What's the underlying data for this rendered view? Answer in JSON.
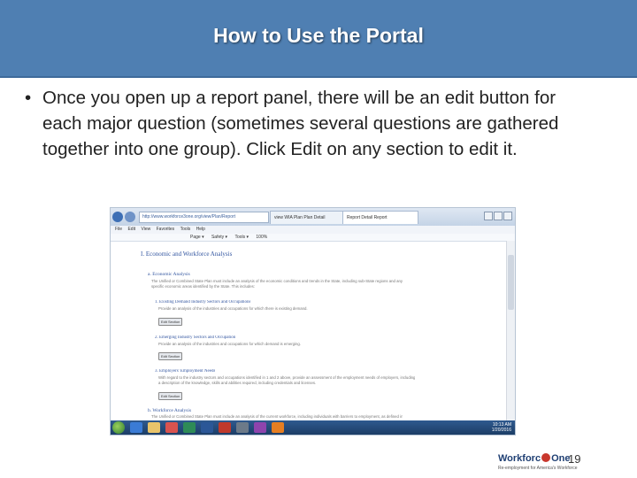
{
  "slide": {
    "title": "How to Use the Portal",
    "bullet_marker": "•",
    "bullet_text": "Once you open up a report panel, there will be an edit button for each major question (sometimes several questions are gathered together into one group). Click Edit on any section to edit it.",
    "page_number": "19"
  },
  "logo": {
    "text_pre": "Workforc",
    "text_post": "One",
    "tagline": "Re-employment for America's Workforce"
  },
  "browser": {
    "address": "http://www.workforce3one.org/view/Plan/Report",
    "tabs": [
      "view WIA Plan Plan Detail",
      "Report Detail Report"
    ],
    "menu": [
      "File",
      "Edit",
      "View",
      "Favorites",
      "Tools",
      "Help"
    ],
    "toolbar": [
      "Page ▾",
      "Safety ▾",
      "Tools ▾",
      "100%"
    ],
    "page": {
      "section_title": "I. Economic and Workforce Analysis",
      "sub_a": "a. Economic Analysis",
      "sub_a_body_1": "The Unified or Combined State Plan must include an analysis of the economic conditions and trends in the State, including sub-State regions and any",
      "sub_a_body_2": "specific economic areas identified by the State. This includes:",
      "item_1": "1. Existing Demand Industry Sectors and Occupations",
      "item_1_body": "Provide an analysis of the industries and occupations for which there is existing demand.",
      "item_2": "2. Emerging Industry Sectors and Occupation",
      "item_2_body": "Provide an analysis of the industries and occupations for which demand is emerging.",
      "item_3": "3. Employers' Employment Needs",
      "item_3_body_1": "With regard to the industry sectors and occupations identified in 1 and 2 above, provide an assessment of the employment needs of employers, including",
      "item_3_body_2": "a description of the knowledge, skills and abilities required, including credentials and licenses.",
      "sub_b": "b. Workforce Analysis",
      "sub_b_body": "The Unified or Combined State Plan must include an analysis of the current workforce, including individuals with barriers to employment, as defined in",
      "edit_label": "Edit Section"
    },
    "clock_time": "10:13 AM",
    "clock_date": "1/20/2016"
  },
  "colors": {
    "title_bar": "#4f7fb2",
    "heading": "#3356a0",
    "taskbar": "#1c3d66"
  }
}
